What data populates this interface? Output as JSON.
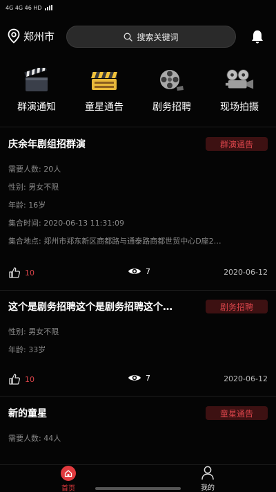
{
  "status_bar": {
    "signal_text": "4G  4G  46 HD"
  },
  "header": {
    "location": "郑州市",
    "search_placeholder": "搜索关键词"
  },
  "categories": [
    {
      "label": "群演通知",
      "icon": "clapperboard-icon"
    },
    {
      "label": "童星通告",
      "icon": "film-slate-icon"
    },
    {
      "label": "剧务招聘",
      "icon": "film-reel-icon"
    },
    {
      "label": "现场拍摄",
      "icon": "movie-camera-icon"
    }
  ],
  "cards": [
    {
      "title": "庆余年剧组招群演",
      "tag": "群演通告",
      "fields": [
        {
          "label": "需要人数:",
          "value": "20人"
        },
        {
          "label": "性别:",
          "value": "男女不限"
        },
        {
          "label": "年龄:",
          "value": "16岁"
        },
        {
          "label": "集合时间:",
          "value": "2020-06-13 11:31:09"
        },
        {
          "label": "集合地点:",
          "value": "郑州市郑东新区商都路与通泰路商都世贸中心D座2…"
        }
      ],
      "likes": "10",
      "views": "7",
      "date": "2020-06-12"
    },
    {
      "title": "这个是剧务招聘这个是剧务招聘这个…",
      "tag": "剧务招聘",
      "fields": [
        {
          "label": "性别:",
          "value": "男女不限"
        },
        {
          "label": "年龄:",
          "value": "33岁"
        }
      ],
      "likes": "10",
      "views": "7",
      "date": "2020-06-12"
    },
    {
      "title": "新的童星",
      "tag": "童星通告",
      "fields": [
        {
          "label": "需要人数:",
          "value": "44人"
        }
      ]
    }
  ],
  "bottom_nav": {
    "home_label": "首页",
    "mine_label": "我的",
    "active_color": "#e03a3e"
  },
  "colors": {
    "accent": "#d9444a",
    "tag_bg": "#3d1112",
    "background": "#050505"
  }
}
